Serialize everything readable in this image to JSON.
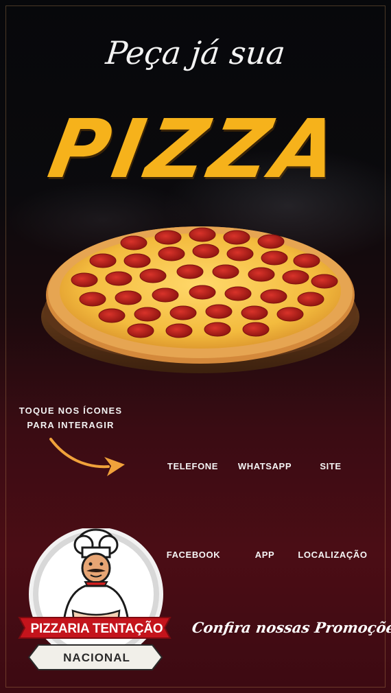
{
  "header": {
    "tagline": "Peça já sua",
    "product": "PIZZA"
  },
  "hint": {
    "line1": "TOQUE NOS ÍCONES",
    "line2": "PARA INTERAGIR"
  },
  "actions": {
    "telefone": "TELEFONE",
    "whatsapp": "WHATSAPP",
    "site": "SITE",
    "facebook": "FACEBOOK",
    "app": "APP",
    "localizacao": "LOCALIZAÇÃO"
  },
  "brand": {
    "name": "PIZZARIA TENTAÇÃO",
    "subtitle": "NACIONAL"
  },
  "promo": {
    "label": "Confira nossas Promoções!"
  },
  "colors": {
    "accent": "#f6b21b",
    "background_top": "#07080b",
    "background_bottom": "#4b0d15",
    "banner_red": "#c4141c"
  }
}
